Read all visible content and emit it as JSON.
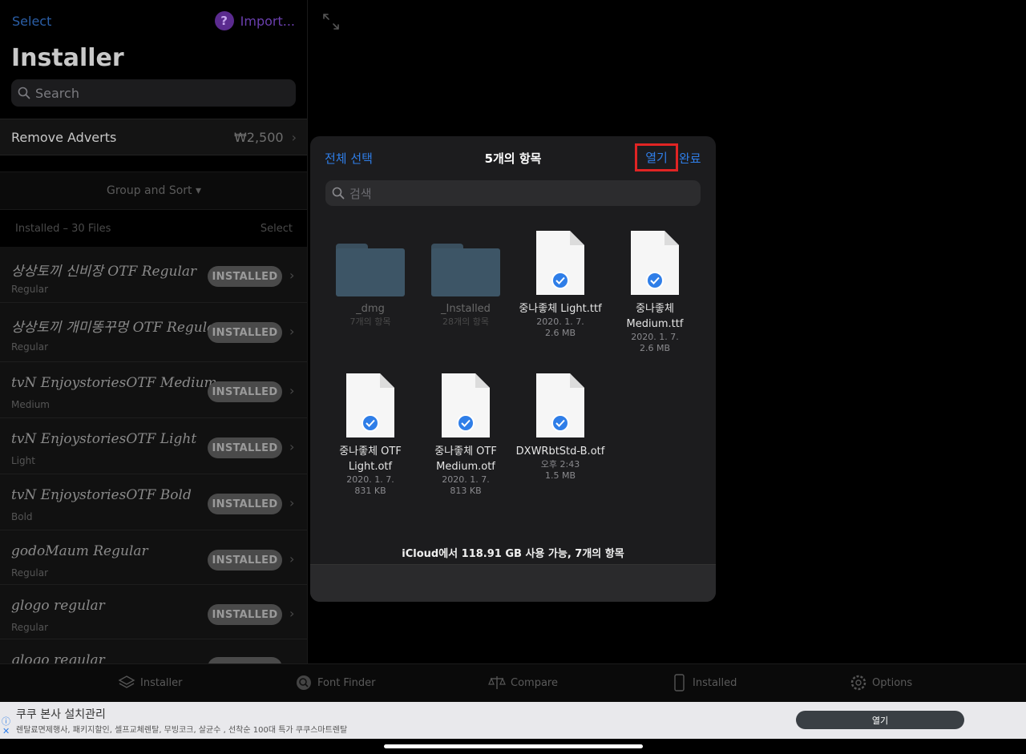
{
  "sidebar": {
    "select_label": "Select",
    "import_label": "Import...",
    "title": "Installer",
    "search_placeholder": "Search",
    "remove_adverts": {
      "label": "Remove Adverts",
      "price": "₩2,500"
    },
    "group_sort": "Group and Sort ▾",
    "section": {
      "label": "Installed – 30 Files",
      "select": "Select"
    },
    "fonts": [
      {
        "name": "상상토끼 신비장 OTF Regular",
        "style": "Regular",
        "badge": "INSTALLED"
      },
      {
        "name": "상상토끼 개미똥꾸멍 OTF Regular",
        "style": "Regular",
        "badge": "INSTALLED"
      },
      {
        "name": "tvN EnjoystoriesOTF Medium",
        "style": "Medium",
        "badge": "INSTALLED"
      },
      {
        "name": "tvN EnjoystoriesOTF Light",
        "style": "Light",
        "badge": "INSTALLED"
      },
      {
        "name": "tvN EnjoystoriesOTF Bold",
        "style": "Bold",
        "badge": "INSTALLED"
      },
      {
        "name": "godoMaum Regular",
        "style": "Regular",
        "badge": "INSTALLED"
      },
      {
        "name": "glogo regular",
        "style": "Regular",
        "badge": "INSTALLED"
      },
      {
        "name": "glogo regular",
        "style": "",
        "badge": ""
      }
    ]
  },
  "picker": {
    "select_all": "전체 선택",
    "title": "5개의 항목",
    "open": "열기",
    "done": "완료",
    "search_placeholder": "검색",
    "items": [
      {
        "type": "folder",
        "name": "_dmg",
        "line1": "7개의 항목",
        "line2": "",
        "selected": false
      },
      {
        "type": "folder",
        "name": "_Installed",
        "line1": "28개의 항목",
        "line2": "",
        "selected": false
      },
      {
        "type": "file",
        "name": "중나좋체 Light.ttf",
        "line1": "2020. 1. 7.",
        "line2": "2.6 MB",
        "selected": true
      },
      {
        "type": "file",
        "name": "중나좋체 Medium.ttf",
        "line1": "2020. 1. 7.",
        "line2": "2.6 MB",
        "selected": true
      },
      {
        "type": "file",
        "name": "중나좋체 OTF Light.otf",
        "line1": "2020. 1. 7.",
        "line2": "831 KB",
        "selected": true
      },
      {
        "type": "file",
        "name": "중나좋체 OTF Medium.otf",
        "line1": "2020. 1. 7.",
        "line2": "813 KB",
        "selected": true
      },
      {
        "type": "file",
        "name": "DXWRbtStd-B.otf",
        "line1": "오후 2:43",
        "line2": "1.5 MB",
        "selected": true
      }
    ],
    "storage": "iCloud에서 118.91 GB 사용 가능, 7개의 항목"
  },
  "tabs": [
    {
      "label": "Installer",
      "icon": "layers-icon"
    },
    {
      "label": "Font Finder",
      "icon": "magnifier-icon"
    },
    {
      "label": "Compare",
      "icon": "scales-icon"
    },
    {
      "label": "Installed",
      "icon": "phone-icon"
    },
    {
      "label": "Options",
      "icon": "gear-icon"
    }
  ],
  "ad": {
    "title": "쿠쿠 본사 설치관리",
    "desc": "렌탈료면제행사, 패키지할인, 셀프교체렌탈, 무빙코크, 살균수 , 선착순 100대 특가 쿠쿠스마트렌탈",
    "button": "열기",
    "info": "ⓘ",
    "close": "✕"
  },
  "colors": {
    "accent": "#2f7ee8",
    "highlight_box": "#e02424",
    "badge_bg": "#4a4a4a"
  }
}
